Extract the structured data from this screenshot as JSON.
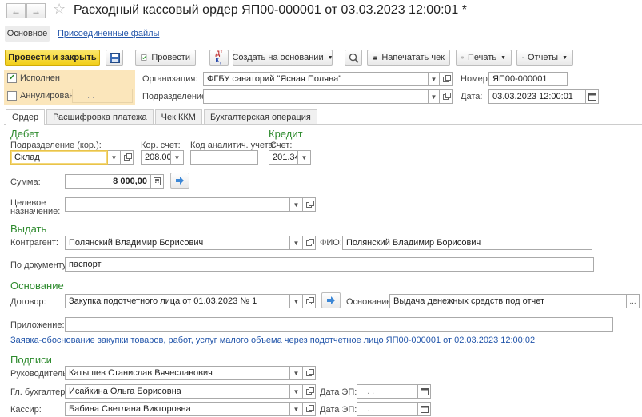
{
  "header": {
    "title": "Расходный кассовый ордер ЯП00-000001 от 03.03.2023 12:00:01 *",
    "star_icon": "star-icon",
    "close_icon": "close-icon"
  },
  "nav": {
    "main": "Основное",
    "attached": "Присоединенные файлы"
  },
  "toolbar": {
    "post_close": "Провести и закрыть",
    "post": "Провести",
    "create_based": "Создать на основании",
    "print_receipt": "Напечатать чек",
    "print": "Печать",
    "reports": "Отчеты",
    "dt_kt": "Дт Кт"
  },
  "status": {
    "executed": "Исполнен",
    "cancelled": "Аннулирован",
    "cancel_date": ". ."
  },
  "top": {
    "org_label": "Организация:",
    "org_value": "ФГБУ санаторий \"Ясная Поляна\"",
    "div_label": "Подразделение:",
    "div_value": "",
    "number_label": "Номер:",
    "number_value": "ЯП00-000001",
    "date_label": "Дата:",
    "date_value": "03.03.2023 12:00:01"
  },
  "tabs": [
    "Ордер",
    "Расшифровка платежа",
    "Чек ККМ",
    "Бухгалтерская операция"
  ],
  "debit": {
    "title": "Дебет",
    "div_label": "Подразделение (кор.):",
    "div_value": "Склад",
    "corr_label": "Кор. счет:",
    "corr_value": "208.00",
    "analytic_label": "Код аналитич. учета:",
    "analytic_value": ""
  },
  "credit": {
    "title": "Кредит",
    "account_label": "Счет:",
    "account_value": "201.34"
  },
  "sum": {
    "label": "Сумма:",
    "value": "8 000,00"
  },
  "purpose": {
    "label_line1": "Целевое",
    "label_line2": "назначение:",
    "value": ""
  },
  "issue": {
    "title": "Выдать",
    "contractor_label": "Контрагент:",
    "contractor_value": "Полянский Владимир Борисович",
    "fio_label": "ФИО:",
    "fio_value": "Полянский Владимир Борисович",
    "document_label": "По документу:",
    "document_value": "паспорт"
  },
  "basis": {
    "title": "Основание",
    "contract_label": "Договор:",
    "contract_value": "Закупка подотчетного лица от 01.03.2023 № 1",
    "basis_label": "Основание:",
    "basis_value": "Выдача денежных средств под отчет",
    "ellipsis": "...",
    "attachment_label": "Приложение:",
    "attachment_value": "",
    "link": "Заявка-обоснование закупки товаров, работ, услуг малого объема через подотчетное лицо ЯП00-000001 от 02.03.2023 12:00:02"
  },
  "signatures": {
    "title": "Подписи",
    "head_label": "Руководитель:",
    "head_value": "Катышев Станислав Вячеславович",
    "chief_label": "Гл. бухгалтер:",
    "chief_value": "Исайкина Ольга Борисовна",
    "cashier_label": "Кассир:",
    "cashier_value": "Бабина Светлана Викторовна",
    "ep_label": "Дата ЭП:",
    "ep_value": ". ."
  },
  "colors": {
    "section_green": "#2e8b2e",
    "primary_yellow": "#f2cf1b",
    "status_panel": "#fbe6bb",
    "link_blue": "#2255aa"
  }
}
